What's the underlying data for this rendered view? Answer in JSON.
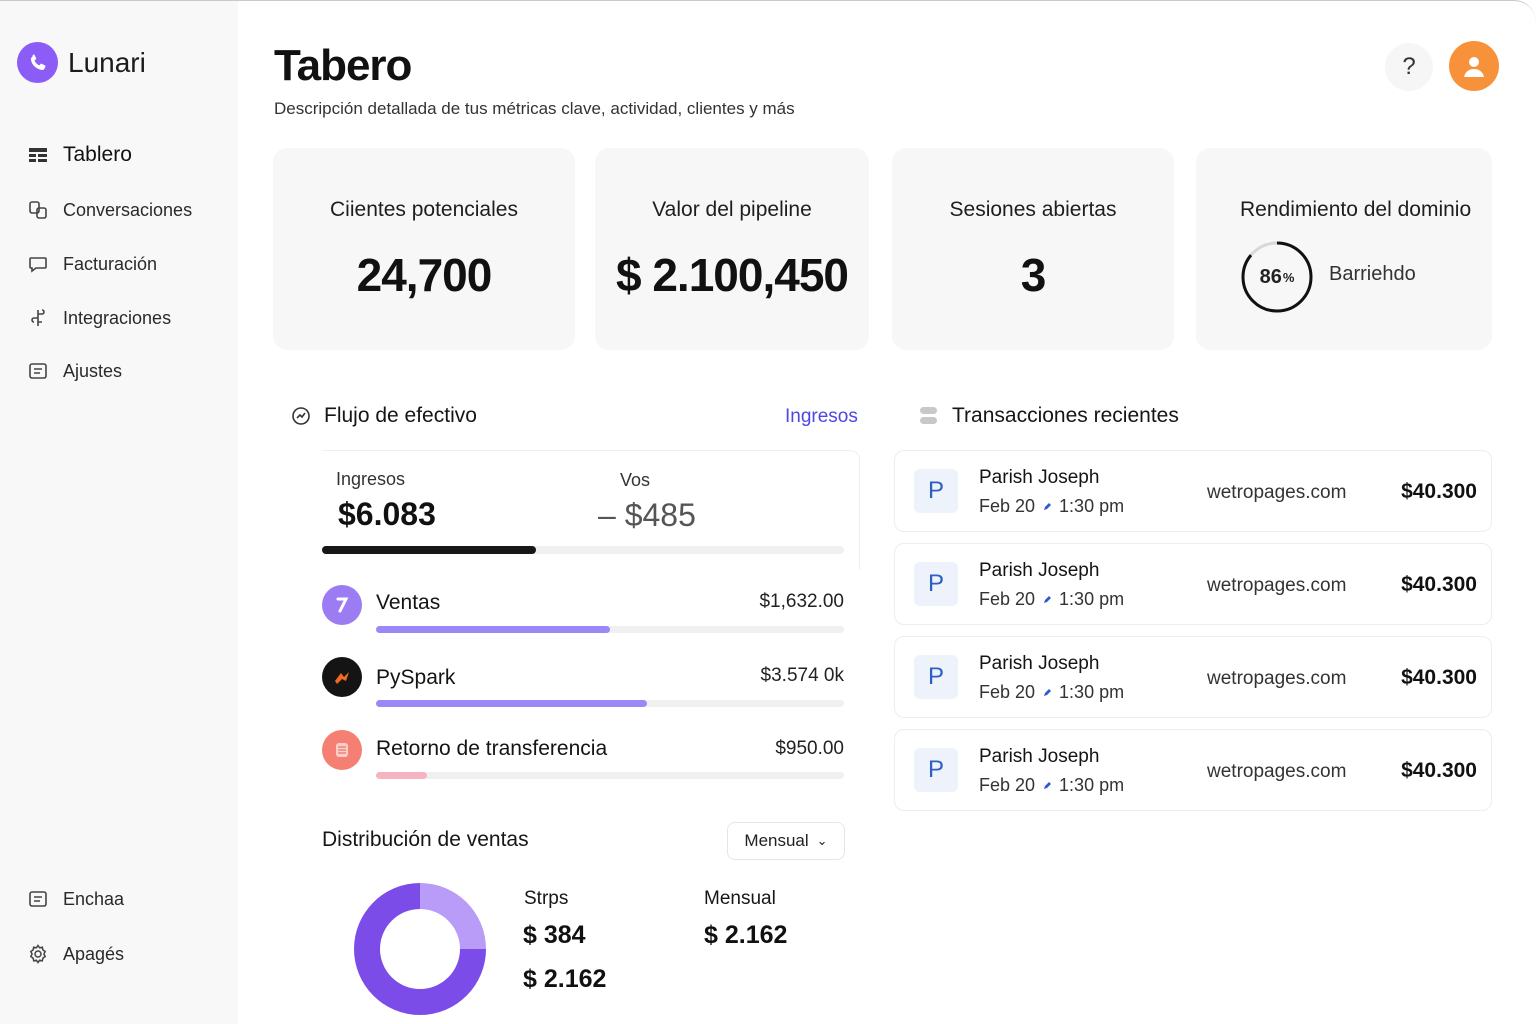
{
  "brand": {
    "name": "Lunari",
    "accent": "#8b5cf6"
  },
  "sidebar": {
    "items": [
      {
        "label": "Tablero",
        "icon": "grid-icon",
        "active": true
      },
      {
        "label": "Conversaciones",
        "icon": "chat-icon"
      },
      {
        "label": "Facturación",
        "icon": "message-icon"
      },
      {
        "label": "Integraciones",
        "icon": "integrations-icon"
      },
      {
        "label": "Ajustes",
        "icon": "settings-list-icon"
      }
    ],
    "bottom_items": [
      {
        "label": "Enchaa",
        "icon": "document-icon"
      },
      {
        "label": "Apagés",
        "icon": "gear-icon"
      }
    ]
  },
  "header": {
    "title": "Tabero",
    "subtitle": "Descripción detallada de tus métricas clave, actividad, clientes y más",
    "help_label": "?",
    "avatar_color": "#f7923a"
  },
  "stats": [
    {
      "label": "Ciientes potenciales",
      "value": "24,700"
    },
    {
      "label": "Valor del pipeline",
      "value": "$ 2.100,450"
    },
    {
      "label": "Sesiones abiertas",
      "value": "3"
    },
    {
      "label": "Rendimiento del dominio",
      "percent": "86",
      "percent_unit": "%",
      "status": "Barriehdo",
      "progress": 0.86
    }
  ],
  "cashflow": {
    "title": "Flujo de efectivo",
    "link": "Ingresos",
    "income_label": "Ingresos",
    "income_value": "$6.083",
    "expense_label": "Vos",
    "expense_value": "– $485",
    "income_progress": 0.41,
    "sources": [
      {
        "name": "Ventas",
        "amount": "$1,632.00",
        "progress": 0.5,
        "color": "#9b87f5",
        "icon": "ventas-icon"
      },
      {
        "name": "PySpark",
        "amount": "$3.574 0k",
        "progress": 0.58,
        "color": "#9b87f5",
        "icon": "pyspark-icon"
      },
      {
        "name": "Retorno de transferencia",
        "amount": "$950.00",
        "progress": 0.11,
        "color": "#f7b3c2",
        "icon": "transfer-icon"
      }
    ]
  },
  "distribution": {
    "title": "Distribución de ventas",
    "period": "Mensual",
    "legend": [
      {
        "label": "Strps",
        "value": "$ 384",
        "color": "#7c5ce0"
      },
      {
        "label": "Mensual",
        "value": "$ 2.162",
        "color": "#444444"
      }
    ],
    "extra_value": "$ 2.162",
    "chart_data": {
      "type": "pie",
      "donut": true,
      "segments": [
        {
          "name": "Strps",
          "value": 25,
          "color": "#b89cf7"
        },
        {
          "name": "Mensual",
          "value": 75,
          "color": "#7c4ce8"
        }
      ]
    }
  },
  "transactions": {
    "title": "Transacciones recientes",
    "items": [
      {
        "initial": "P",
        "name": "Parish Joseph",
        "date": "Feb 20",
        "time": "1:30 pm",
        "domain": "wetropages.com",
        "amount": "$40.300"
      },
      {
        "initial": "P",
        "name": "Parish Joseph",
        "date": "Feb 20",
        "time": "1:30 pm",
        "domain": "wetropages.com",
        "amount": "$40.300"
      },
      {
        "initial": "P",
        "name": "Parish Joseph",
        "date": "Feb 20",
        "time": "1:30 pm",
        "domain": "wetropages.com",
        "amount": "$40.300"
      },
      {
        "initial": "P",
        "name": "Parish Joseph",
        "date": "Feb 20",
        "time": "1:30 pm",
        "domain": "wetropages.com",
        "amount": "$40.300"
      }
    ]
  }
}
